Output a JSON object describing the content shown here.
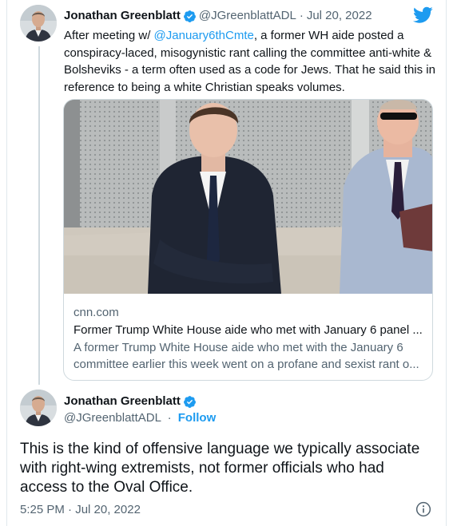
{
  "colors": {
    "accent": "#1d9bf0",
    "text": "#0f1419",
    "muted": "#536471",
    "border": "#cfd9de"
  },
  "tweet1": {
    "name": "Jonathan Greenblatt",
    "verified_icon": "verified-badge-icon",
    "handle": "@JGreenblattADL",
    "separator": "·",
    "date": "Jul 20, 2022",
    "text_before_mention": "After meeting w/ ",
    "mention": "@January6thCmte",
    "text_after_mention": ", a former WH aide posted a conspiracy-laced, misogynistic rant calling the committee anti-white & Bolsheviks - a term often used as a code for Jews. That he said this in reference to being a white Christian speaks volumes.",
    "card": {
      "domain": "cnn.com",
      "title": "Former Trump White House aide who met with January 6 panel ...",
      "description": "A former Trump White House aide who met with the January 6 committee earlier this week went on a profane and sexist rant o..."
    }
  },
  "tweet2": {
    "name": "Jonathan Greenblatt",
    "handle": "@JGreenblattADL",
    "separator": "·",
    "follow_label": "Follow",
    "text": "This is the kind of offensive language we typically associate with right-wing extremists, not former officials who had access to the Oval Office.",
    "timestamp": "5:25 PM · Jul 20, 2022"
  },
  "icons": {
    "brand": "twitter-bird-icon",
    "info": "info-icon"
  }
}
